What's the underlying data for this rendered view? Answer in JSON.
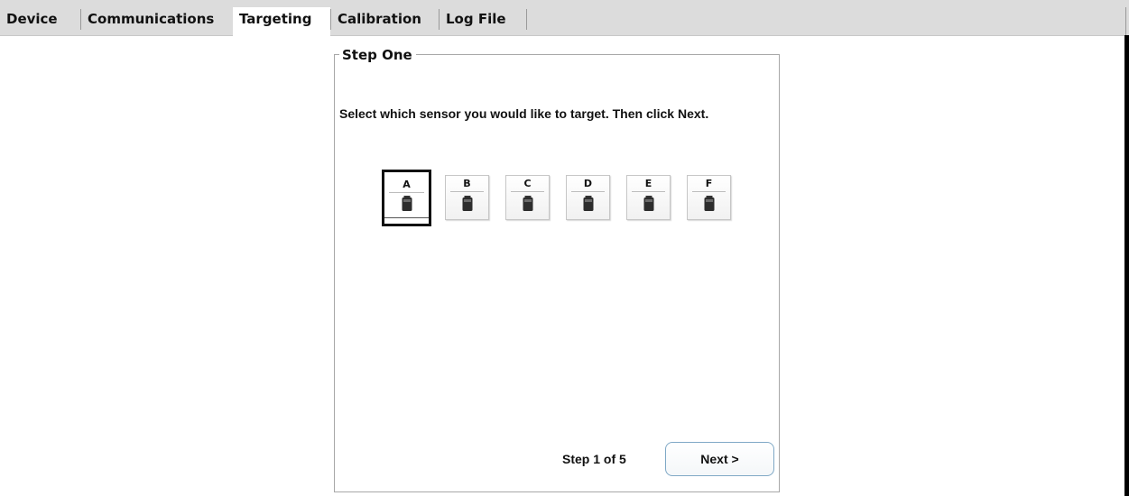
{
  "tabs": [
    {
      "label": "Device"
    },
    {
      "label": "Communications"
    },
    {
      "label": "Targeting",
      "active": true
    },
    {
      "label": "Calibration"
    },
    {
      "label": "Log File"
    }
  ],
  "panel": {
    "legend": "Step One",
    "instructions": "Select which sensor you would like to target.  Then click Next.",
    "sensors": [
      {
        "label": "A",
        "selected": true,
        "icon": "sensor-device-icon"
      },
      {
        "label": "B",
        "icon": "sensor-device-icon"
      },
      {
        "label": "C",
        "icon": "sensor-device-icon"
      },
      {
        "label": "D",
        "icon": "sensor-device-icon"
      },
      {
        "label": "E",
        "icon": "sensor-device-icon"
      },
      {
        "label": "F",
        "icon": "sensor-device-icon"
      }
    ],
    "step_count": "Step 1 of 5",
    "next_label": "Next >"
  },
  "colors": {
    "tabbar_bg": "#dcdcdc",
    "next_border": "#7fa8c6"
  }
}
